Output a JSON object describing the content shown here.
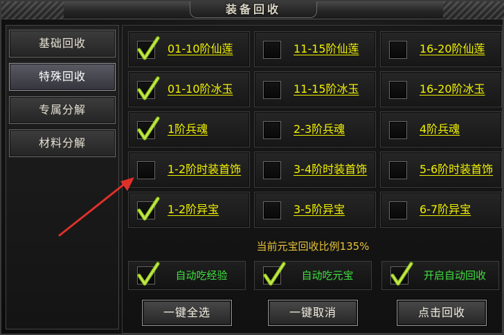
{
  "window": {
    "title": "装备回收"
  },
  "sidebar": {
    "items": [
      {
        "label": "基础回收",
        "active": false
      },
      {
        "label": "特殊回收",
        "active": true
      },
      {
        "label": "专属分解",
        "active": false
      },
      {
        "label": "材料分解",
        "active": false
      }
    ]
  },
  "grid": {
    "rows": [
      [
        {
          "label": "01-10阶仙莲",
          "checked": true
        },
        {
          "label": "11-15阶仙莲",
          "checked": false
        },
        {
          "label": "16-20阶仙莲",
          "checked": false
        }
      ],
      [
        {
          "label": "01-10阶冰玉",
          "checked": true
        },
        {
          "label": "11-15阶冰玉",
          "checked": false
        },
        {
          "label": "16-20阶冰玉",
          "checked": false
        }
      ],
      [
        {
          "label": "1阶兵魂",
          "checked": true
        },
        {
          "label": "2-3阶兵魂",
          "checked": false
        },
        {
          "label": "4阶兵魂",
          "checked": false
        }
      ],
      [
        {
          "label": "1-2阶时装首饰",
          "checked": false
        },
        {
          "label": "3-4阶时装首饰",
          "checked": false
        },
        {
          "label": "5-6阶时装首饰",
          "checked": false
        }
      ],
      [
        {
          "label": "1-2阶异宝",
          "checked": true
        },
        {
          "label": "3-5阶异宝",
          "checked": false
        },
        {
          "label": "6-7阶异宝",
          "checked": false
        }
      ]
    ]
  },
  "ratio_text": "当前元宝回收比例135%",
  "auto_options": [
    {
      "label": "自动吃经验",
      "checked": true
    },
    {
      "label": "自动吃元宝",
      "checked": true
    },
    {
      "label": "开启自动回收",
      "checked": true
    }
  ],
  "actions": {
    "select_all": "一键全选",
    "cancel_all": "一键取消",
    "recycle": "点击回收"
  },
  "colors": {
    "item_label": "#f2f200",
    "auto_label": "#3fe03f",
    "ratio": "#e8c33a",
    "check": "#9acd1e",
    "arrow": "#e0302a"
  }
}
